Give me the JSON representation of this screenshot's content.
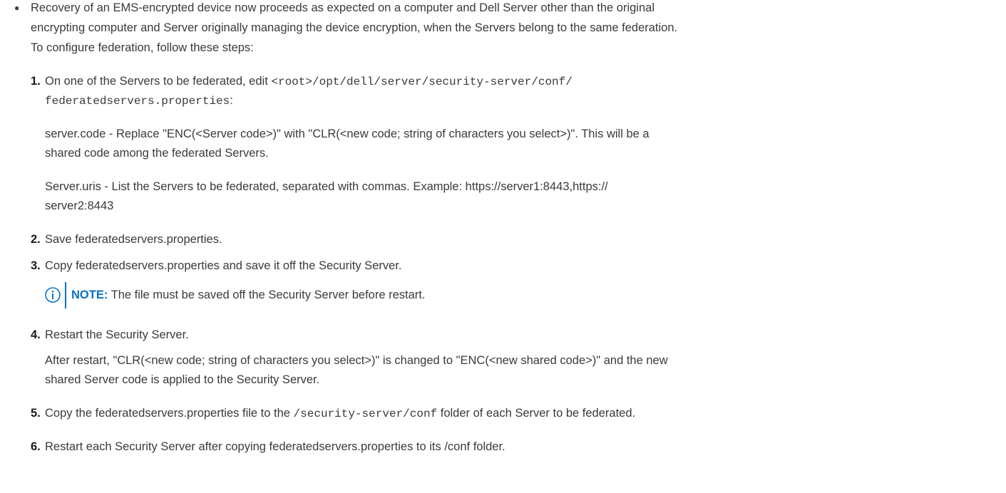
{
  "intro": {
    "line1": "Recovery of an EMS-encrypted device now proceeds as expected on a computer and Dell Server other than the original",
    "line2": "encrypting computer and Server originally managing the device encryption, when the Servers belong to the same federation.",
    "line3": "To configure federation, follow these steps:"
  },
  "steps": [
    {
      "number": "1.",
      "line1_prefix": "On one of the Servers to be federated, edit ",
      "line1_code": "<root>/opt/dell/server/security-server/conf/",
      "line2_code": "federatedservers.properties",
      "line2_suffix": ":",
      "para1_line1": "server.code - Replace \"ENC(<Server code>)\" with \"CLR(<new code; string of characters you select>)\". This will be a",
      "para1_line2": "shared code among the federated Servers.",
      "para2_line1": "Server.uris - List the Servers to be federated, separated with commas. Example: https://server1:8443,https://",
      "para2_line2": "server2:8443"
    },
    {
      "number": "2.",
      "text": "Save federatedservers.properties."
    },
    {
      "number": "3.",
      "text": "Copy federatedservers.properties and save it off the Security Server."
    },
    {
      "number": "4.",
      "text": "Restart the Security Server.",
      "para_line1": "After restart, \"CLR(<new code; string of characters you select>)\" is changed to \"ENC(<new shared code>)\" and the new",
      "para_line2": "shared Server code is applied to the Security Server."
    },
    {
      "number": "5.",
      "prefix": "Copy the federatedservers.properties file to the ",
      "code": "/security-server/conf",
      "suffix": " folder of each Server to be federated."
    },
    {
      "number": "6.",
      "text": "Restart each Security Server after copying federatedservers.properties to its /conf folder."
    }
  ],
  "note": {
    "icon": "info-icon",
    "label": "NOTE:",
    "text": " The file must be saved off the Security Server before restart."
  },
  "colors": {
    "text": "#3a3a3a",
    "accent": "#0672cb"
  }
}
